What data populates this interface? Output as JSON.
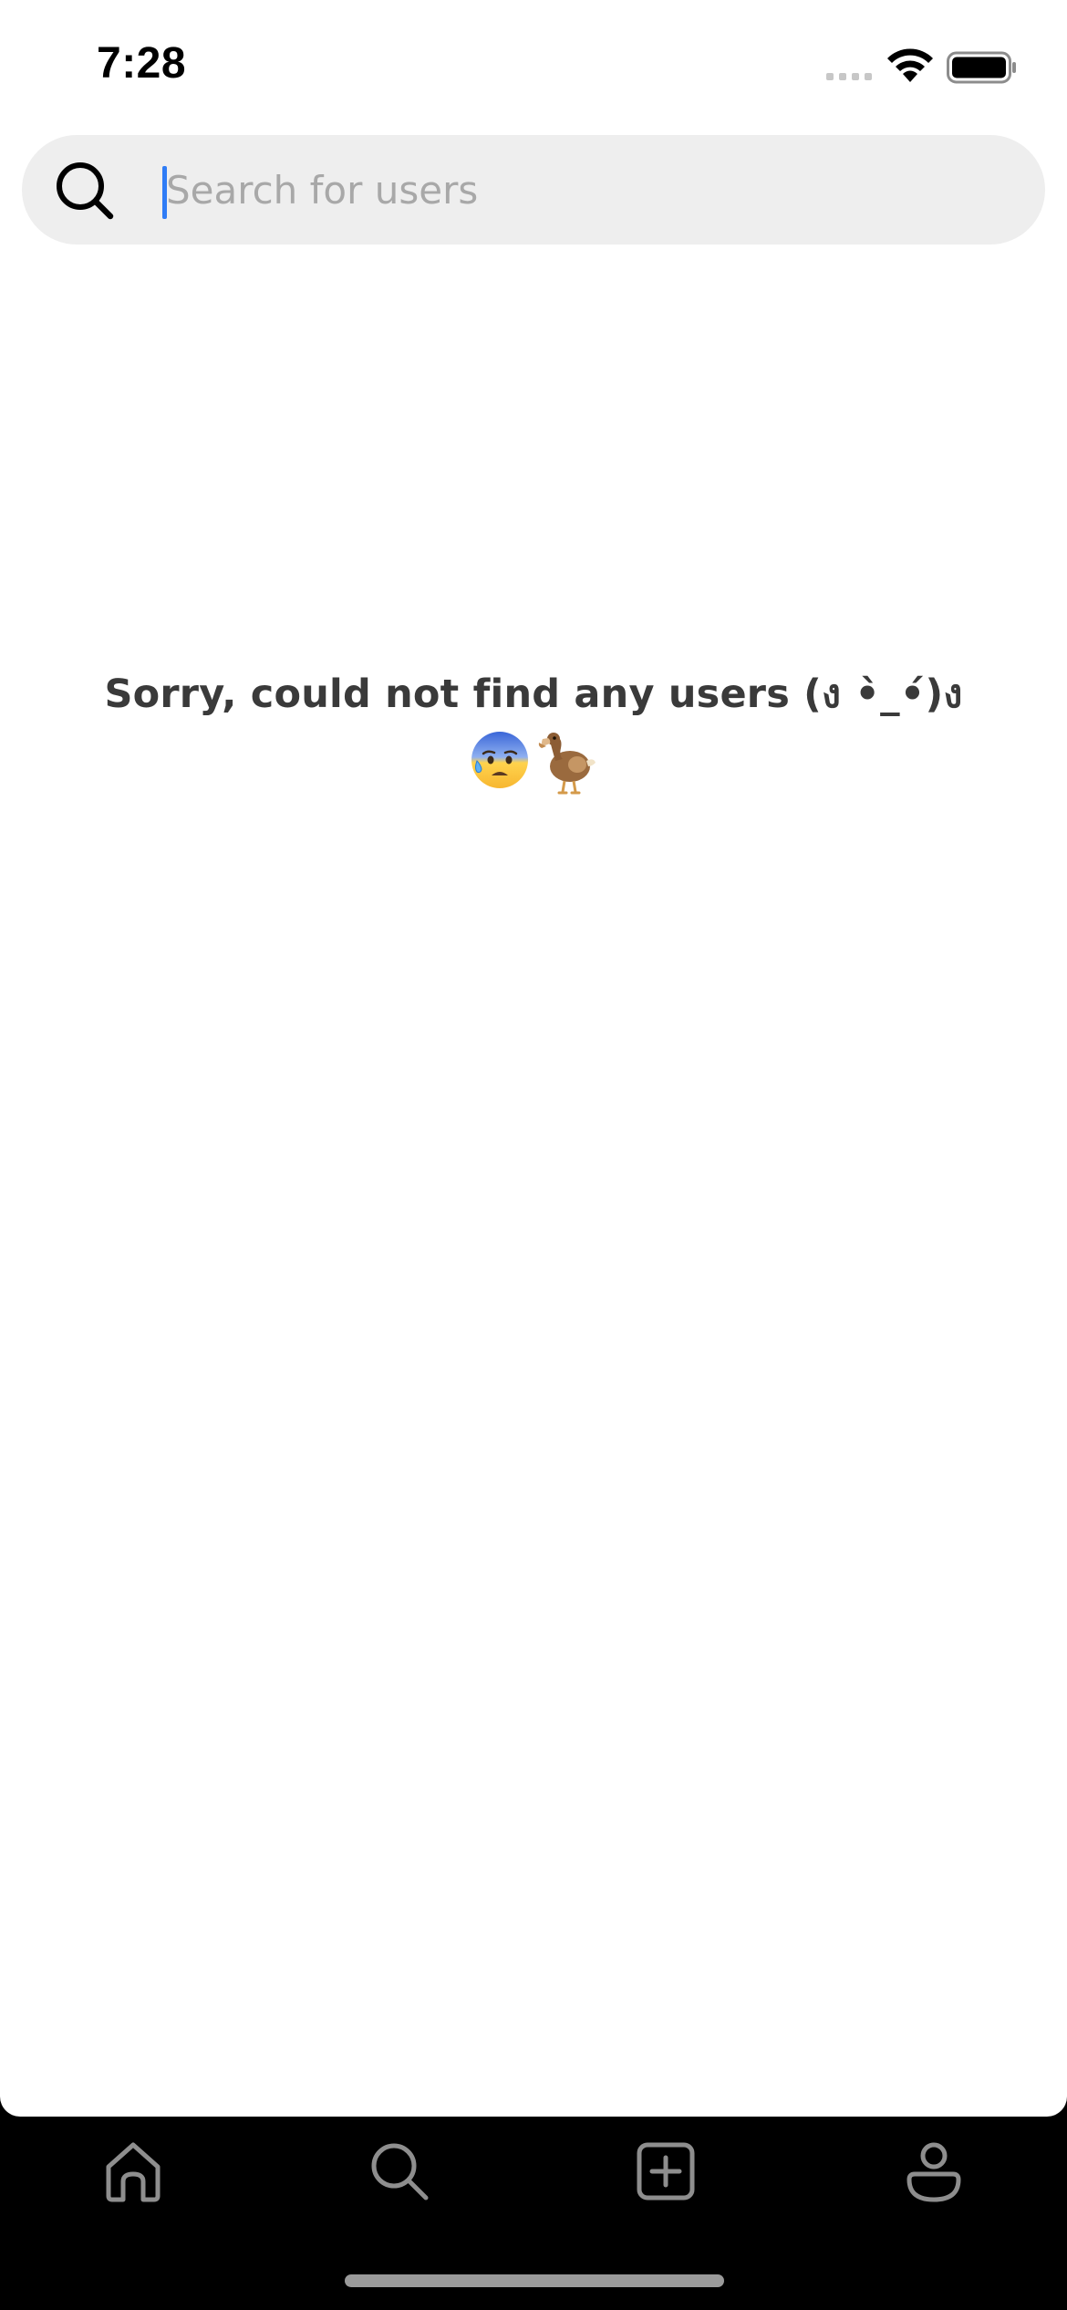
{
  "status_bar": {
    "time": "7:28"
  },
  "search": {
    "placeholder": "Search for users",
    "value": ""
  },
  "empty_state": {
    "message": "Sorry, could not find any users (ง •̀_•́)ง",
    "emojis": [
      "anxious-face-with-sweat",
      "dodo"
    ]
  },
  "tab_bar": {
    "tabs": [
      {
        "name": "home",
        "icon": "home-icon"
      },
      {
        "name": "search",
        "icon": "search-icon"
      },
      {
        "name": "create",
        "icon": "plus-square-icon"
      },
      {
        "name": "profile",
        "icon": "user-icon"
      }
    ]
  },
  "colors": {
    "background": "#ffffff",
    "search_background": "#eeeeee",
    "placeholder": "#a8a8a8",
    "caret": "#2f7cf6",
    "message_text": "#3a3a3a",
    "tab_bar_background": "#000000",
    "tab_icon": "#8e8e8e"
  }
}
